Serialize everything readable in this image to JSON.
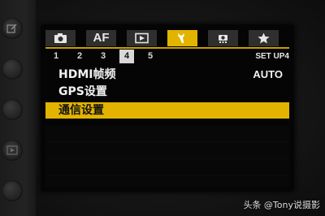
{
  "tabs": [
    {
      "id": "camera",
      "icon": "camera-icon",
      "label": ""
    },
    {
      "id": "af",
      "icon": "",
      "label": "AF"
    },
    {
      "id": "playback",
      "icon": "playback-icon",
      "label": ""
    },
    {
      "id": "setup",
      "icon": "wrench-icon",
      "label": "",
      "active": true
    },
    {
      "id": "custom",
      "icon": "custom-functions-icon",
      "label": ""
    },
    {
      "id": "mymenu",
      "icon": "star-icon",
      "label": ""
    }
  ],
  "pages": [
    "1",
    "2",
    "3",
    "4",
    "5"
  ],
  "active_page": "4",
  "menu_id": "SET UP4",
  "items": [
    {
      "label": "HDMI帧频",
      "value": "AUTO"
    },
    {
      "label": "GPS设置",
      "value": ""
    },
    {
      "label": "通信设置",
      "value": "",
      "selected": true
    }
  ],
  "watermark": "头条 @Tony说摄影",
  "colors": {
    "accent": "#e2b400",
    "tab_bg": "#2f2f2f",
    "screen_bg": "#050505"
  }
}
